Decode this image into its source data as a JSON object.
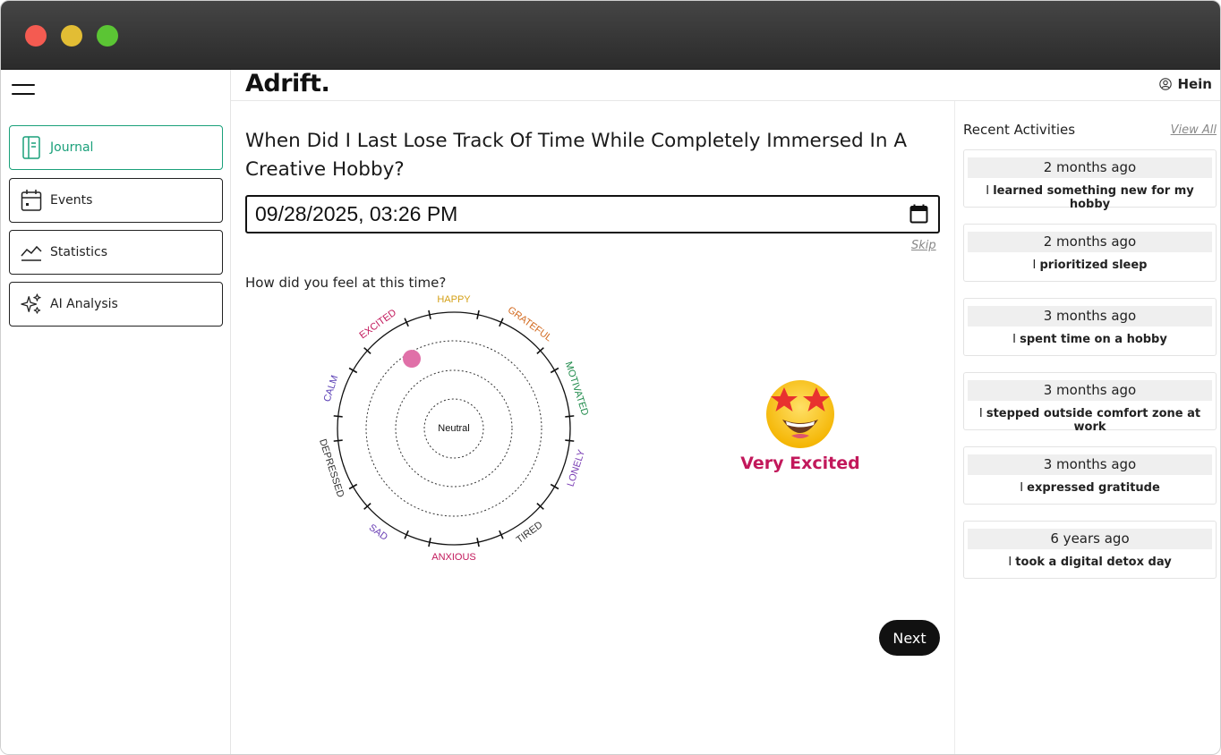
{
  "app": {
    "brand": "Adrift.",
    "user_name": "Hein"
  },
  "sidebar": {
    "items": [
      {
        "label": "Journal",
        "icon": "journal-icon",
        "active": true
      },
      {
        "label": "Events",
        "icon": "calendar-icon",
        "active": false
      },
      {
        "label": "Statistics",
        "icon": "chart-line-icon",
        "active": false
      },
      {
        "label": "AI Analysis",
        "icon": "sparkles-icon",
        "active": false
      }
    ]
  },
  "main": {
    "question": "When Did I Last Lose Track Of Time While Completely Immersed In A Creative Hobby?",
    "datetime_value": "09/28/2025, 03:26 PM",
    "skip_label": "Skip",
    "feel_question": "How did you feel at this time?",
    "wheel": {
      "center_label": "Neutral",
      "moods": [
        {
          "label": "HAPPY",
          "color": "#d4a017"
        },
        {
          "label": "GRATEFUL",
          "color": "#d2691e"
        },
        {
          "label": "MOTIVATED",
          "color": "#1e8a4a"
        },
        {
          "label": "LONELY",
          "color": "#7b3fb5"
        },
        {
          "label": "TIRED",
          "color": "#333333"
        },
        {
          "label": "ANXIOUS",
          "color": "#c2185b"
        },
        {
          "label": "SAD",
          "color": "#6a3fb5"
        },
        {
          "label": "DEPRESSED",
          "color": "#333333"
        },
        {
          "label": "CALM",
          "color": "#5a3fb5"
        },
        {
          "label": "EXCITED",
          "color": "#c2185b"
        }
      ],
      "marker_color": "#e070a8"
    },
    "selected_mood": "Very Excited",
    "selected_mood_color": "#c2185b",
    "next_label": "Next"
  },
  "recent": {
    "title": "Recent Activities",
    "view_all_label": "View All",
    "items": [
      {
        "when": "2 months ago",
        "lead": "I",
        "body": "learned something new for my hobby"
      },
      {
        "when": "2 months ago",
        "lead": "I",
        "body": "prioritized sleep"
      },
      {
        "when": "3 months ago",
        "lead": "I",
        "body": "spent time on a hobby"
      },
      {
        "when": "3 months ago",
        "lead": "I",
        "body": "stepped outside comfort zone at work"
      },
      {
        "when": "3 months ago",
        "lead": "I",
        "body": "expressed gratitude"
      },
      {
        "when": "6 years ago",
        "lead": "I",
        "body": "took a digital detox day"
      }
    ]
  }
}
